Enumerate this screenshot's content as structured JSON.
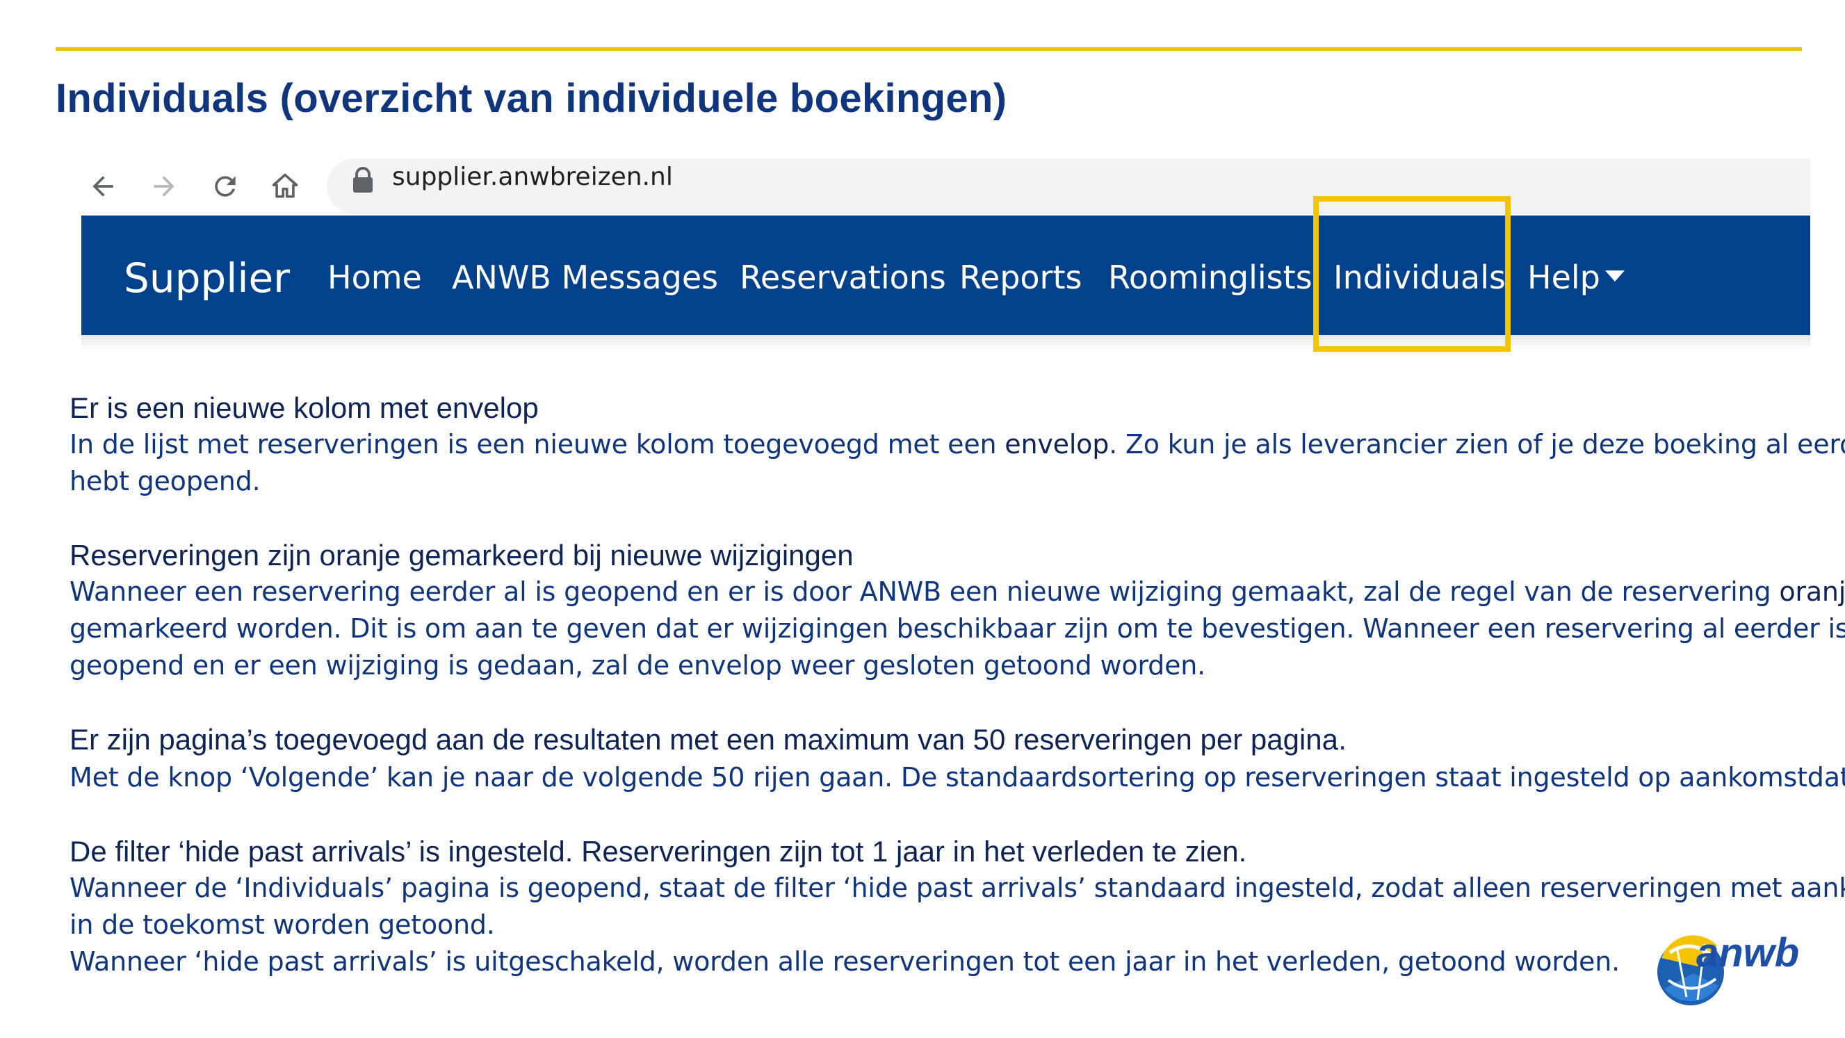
{
  "slide": {
    "title": "Individuals (overzicht van individuele boekingen)"
  },
  "browser": {
    "url": "supplier.anwbreizen.nl",
    "icons": [
      "back-arrow-icon",
      "forward-arrow-icon",
      "reload-icon",
      "home-icon",
      "lock-icon"
    ]
  },
  "navbar": {
    "brand": "Supplier",
    "items": [
      {
        "label": "Home"
      },
      {
        "label": "ANWB Messages"
      },
      {
        "label": "Reservations"
      },
      {
        "label": "Reports"
      },
      {
        "label": "Roominglists"
      },
      {
        "label": "Individuals"
      },
      {
        "label": "Help"
      }
    ],
    "highlighted_item": "Individuals",
    "colors": {
      "bar": "#02418c",
      "highlight": "#f5c400"
    }
  },
  "sections": [
    {
      "heading": "Er is een nieuwe kolom met envelop",
      "lines": [
        {
          "pre": "In de lijst met reserveringen is een nieuwe kolom toegevoegd met een ",
          "emph": "envelop",
          "post": ". Zo kun je als leverancier zien of je deze boeking al eerder"
        },
        {
          "pre": "hebt geopend."
        }
      ]
    },
    {
      "heading": "Reserveringen zijn oranje gemarkeerd bij nieuwe wijzigingen",
      "lines": [
        {
          "pre": "Wanneer een reservering eerder al is geopend en er is door ANWB een nieuwe wijziging gemaakt, zal de regel van de reservering ",
          "emph": "oranje"
        },
        {
          "pre": "gemarkeerd worden. Dit is om aan te geven dat er wijzigingen beschikbaar zijn om te bevestigen. Wanneer een reservering al eerder is"
        },
        {
          "pre": "geopend en er een wijziging is gedaan, zal de envelop weer gesloten getoond worden."
        }
      ]
    },
    {
      "heading": "Er zijn pagina’s toegevoegd aan de resultaten met een maximum van 50 reserveringen per pagina",
      "heading_suffix": ".",
      "lines": [
        {
          "pre": "Met de knop ‘Volgende’ kan je naar de volgende 50 rijen gaan. De standaardsortering op reserveringen staat ingesteld op aankomstdatum."
        }
      ]
    },
    {
      "heading": "De filter ‘hide past arrivals’ is ingesteld. Reserveringen zijn tot 1 jaar in het verleden te zien.",
      "lines": [
        {
          "pre": "Wanneer de ‘Individuals’ pagina is geopend, staat de filter ‘hide past arrivals’ standaard ingesteld, zodat alleen reserveringen met aankomst"
        },
        {
          "pre": "in de toekomst worden getoond."
        },
        {
          "pre": "Wanneer ‘hide past arrivals’ is uitgeschakeld, worden alle reserveringen tot een jaar in het verleden, getoond worden."
        }
      ]
    }
  ],
  "logo": {
    "text": "anwb",
    "colors": {
      "yellow": "#f5c400",
      "blue": "#1d5fb0"
    }
  }
}
